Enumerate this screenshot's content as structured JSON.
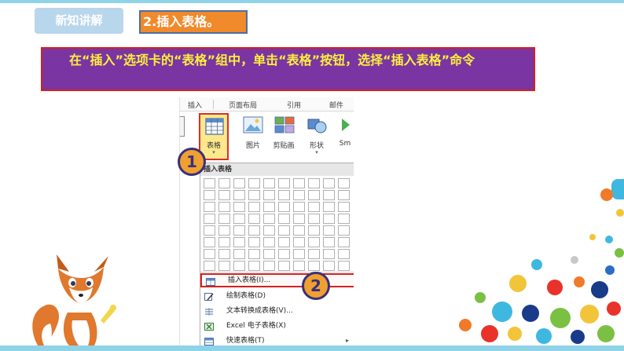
{
  "header": {
    "badge": "新知讲解",
    "section_title": "2.插入表格。"
  },
  "instruction": "在“插入”选项卡的“表格”组中，单击“表格”按钮，选择“插入表格”命令",
  "ribbon": {
    "tabs": [
      "插入",
      "页面布局",
      "引用",
      "邮件"
    ],
    "buttons": [
      {
        "label": "表格",
        "icon": "table-icon"
      },
      {
        "label": "图片",
        "icon": "picture-icon"
      },
      {
        "label": "剪贴画",
        "icon": "clipart-icon"
      },
      {
        "label": "形状",
        "icon": "shapes-icon"
      },
      {
        "label": "Sm",
        "icon": "smartart-icon"
      }
    ],
    "dropdown_arrow": "▾"
  },
  "menu": {
    "header": "插入表格",
    "grid": {
      "rows": 8,
      "cols": 10
    },
    "items": [
      {
        "label": "插入表格(I)...",
        "icon": "insert-table-icon",
        "highlighted": true
      },
      {
        "label": "绘制表格(D)",
        "icon": "draw-table-icon"
      },
      {
        "label": "文本转换成表格(V)...",
        "icon": "convert-text-icon"
      },
      {
        "label": "Excel 电子表格(X)",
        "icon": "excel-icon"
      },
      {
        "label": "快速表格(T)",
        "icon": "quick-table-icon",
        "has_submenu": true
      }
    ],
    "submenu_arrow": "▸"
  },
  "callouts": [
    "1",
    "2"
  ],
  "colors": {
    "badge": "#b8d6ec",
    "section_title_bg": "#f08a2a",
    "instruction_bg": "#7a35a2",
    "instruction_text": "#ffef3b",
    "highlight_border": "#d42020",
    "callout_fill": "#f0a030"
  }
}
